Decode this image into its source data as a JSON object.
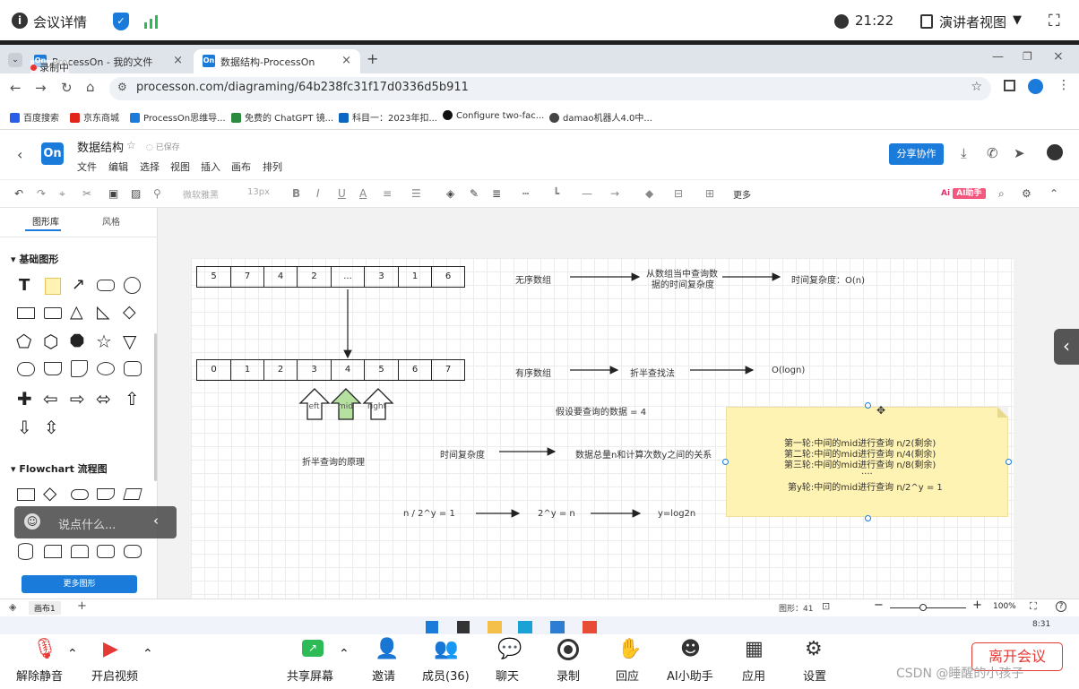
{
  "meeting": {
    "title": "会议详情",
    "time": "21:22",
    "view": "演讲者视图"
  },
  "tabs": [
    {
      "label": "ProcessOn - 我的文件",
      "fav": "On"
    },
    {
      "label": "数据结构-ProcessOn",
      "fav": "On"
    }
  ],
  "recording": "录制中",
  "url": "processon.com/diagraming/64b238fc31f17d0336d5b911",
  "bookmarks": [
    "百度搜索",
    "京东商城",
    "ProcessOn思维导...",
    "免费的 ChatGPT 镜...",
    "科目一：2023年扣...",
    "Configure two-fac...",
    "damao机器人4.0中..."
  ],
  "doc": {
    "logo": "On",
    "title": "数据结构",
    "saved": "已保存",
    "menus": [
      "文件",
      "编辑",
      "选择",
      "视图",
      "插入",
      "画布",
      "排列"
    ],
    "share": "分享协作"
  },
  "toolbar": {
    "font": "微软雅黑",
    "size": "13px",
    "more": "更多",
    "ai": "AI助手"
  },
  "sidebar": {
    "tab1": "图形库",
    "tab2": "风格",
    "sec1": "基础图形",
    "sec2": "Flowchart 流程图",
    "more": "更多图形"
  },
  "comment": "说点什么...",
  "diagram": {
    "row1": [
      "5",
      "7",
      "4",
      "2",
      "...",
      "3",
      "1",
      "6"
    ],
    "row2": [
      "0",
      "1",
      "2",
      "3",
      "4",
      "5",
      "6",
      "7"
    ],
    "t_unsorted": "无序数组",
    "t_query": "从数组当中查询数",
    "t_query2": "据的时间复杂度",
    "t_on": "时间复杂度：O(n)",
    "t_sorted": "有序数组",
    "t_bin": "折半查找法",
    "t_ologn": "O(logn)",
    "t_left": "left",
    "t_mid": "mid",
    "t_right": "right",
    "t_assume": "假设要查询的数据 = 4",
    "t_principle": "折半查询的原理",
    "t_tc": "时间复杂度",
    "t_rel": "数据总量n和计算次数y之间的关系",
    "note": [
      "第一轮:中间的mid进行查询      n/2(剩余)",
      "第二轮:中间的mid进行查询      n/4(剩余)",
      "第三轮:中间的mid进行查询      n/8(剩余)",
      "....",
      "第y轮:中间的mid进行查询   n/2^y = 1"
    ],
    "f1": "n / 2^y = 1",
    "f2": "2^y = n",
    "f3": "y=log2n"
  },
  "status": {
    "page": "画布1",
    "shapes": "图形：41",
    "zoom": "100%"
  },
  "taskbar_time": "8:31",
  "bottom": [
    "解除静音",
    "开启视频",
    "共享屏幕",
    "邀请",
    "成员(36)",
    "聊天",
    "录制",
    "回应",
    "AI小助手",
    "应用",
    "设置",
    "离开会议"
  ],
  "watermark": "CSDN @睡醒的小孩子"
}
